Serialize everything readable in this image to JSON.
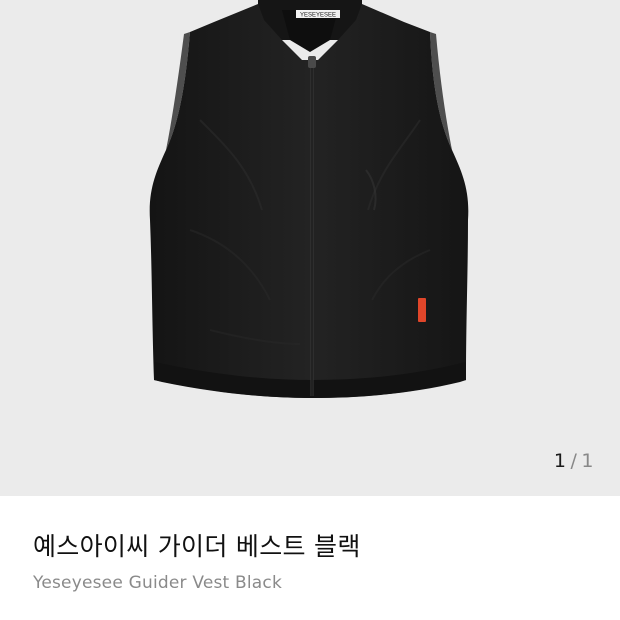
{
  "gallery": {
    "image_alt": "Yeseyesee Guider Vest Black",
    "collar_logo_text": "YESEYESEE",
    "pager": {
      "current": "1",
      "separator": "/",
      "total": "1"
    }
  },
  "product": {
    "name_ko": "예스아이씨 가이더 베스트 블랙",
    "name_en": "Yeseyesee Guider Vest Black"
  },
  "colors": {
    "gallery_bg": "#ebebeb",
    "vest": "#1c1c1c",
    "tag": "#e0462a",
    "title": "#111111",
    "subtitle": "#8a8a8a"
  }
}
